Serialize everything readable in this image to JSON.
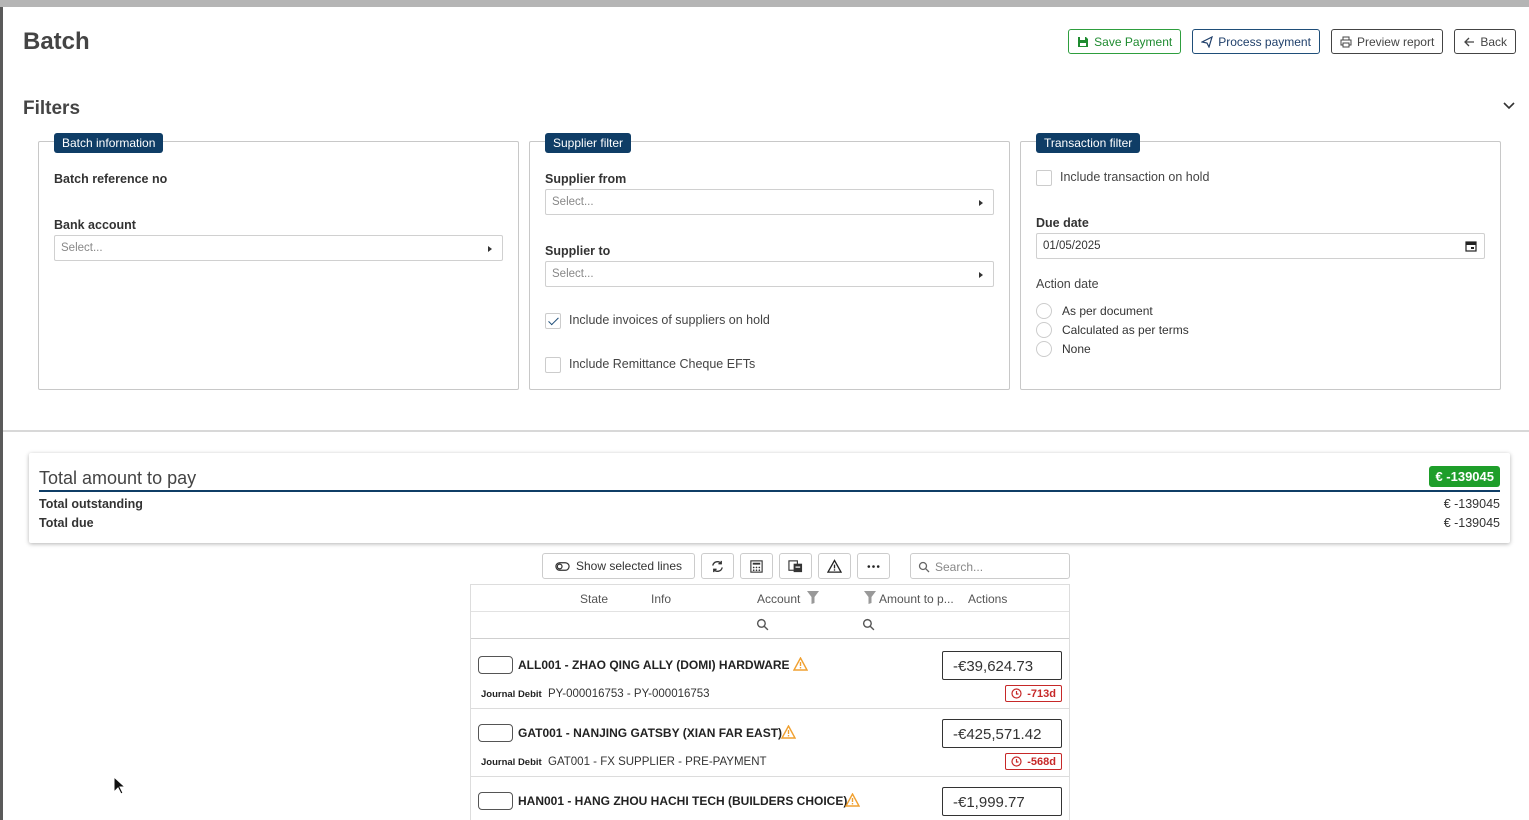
{
  "page": {
    "title": "Batch"
  },
  "actions": {
    "save": "Save Payment",
    "process": "Process payment",
    "preview": "Preview report",
    "back": "Back"
  },
  "filters": {
    "title": "Filters",
    "batch_info": {
      "tag": "Batch information",
      "ref_label": "Batch reference no",
      "bank_label": "Bank account",
      "bank_placeholder": "Select..."
    },
    "supplier": {
      "tag": "Supplier filter",
      "from_label": "Supplier from",
      "from_placeholder": "Select...",
      "to_label": "Supplier to",
      "to_placeholder": "Select...",
      "include_on_hold": "Include invoices of suppliers on hold",
      "include_on_hold_checked": true,
      "include_remittance": "Include Remittance Cheque EFTs",
      "include_remittance_checked": false
    },
    "transaction": {
      "tag": "Transaction filter",
      "include_hold": "Include transaction on hold",
      "include_hold_checked": false,
      "due_label": "Due date",
      "due_value": "01/05/2025",
      "action_label": "Action date",
      "options": [
        "As per document",
        "Calculated as per terms",
        "None"
      ]
    }
  },
  "totals": {
    "title": "Total amount to pay",
    "badge": "€ -139045",
    "outstanding_label": "Total outstanding",
    "outstanding_value": "€ -139045",
    "due_label": "Total due",
    "due_value": "€ -139045"
  },
  "toolbar": {
    "show_selected": "Show selected lines",
    "search_placeholder": "Search..."
  },
  "grid": {
    "columns": {
      "state": "State",
      "info": "Info",
      "account": "Account",
      "amount": "Amount to p...",
      "actions": "Actions"
    },
    "rows": [
      {
        "name": "ALL001 - ZHAO QING ALLY (DOMI) HARDWARE",
        "type": "Journal Debit",
        "desc": "PY-000016753 - PY-000016753",
        "amount": "-€39,624.73",
        "days": "-713d"
      },
      {
        "name": "GAT001 - NANJING GATSBY (XIAN FAR EAST)",
        "type": "Journal Debit",
        "desc": "GAT001 - FX SUPPLIER - PRE-PAYMENT",
        "amount": "-€425,571.42",
        "days": "-568d"
      },
      {
        "name": "HAN001 - HANG ZHOU HACHI TECH (BUILDERS CHOICE)",
        "type": "",
        "desc": "",
        "amount": "-€1,999.77",
        "days": ""
      }
    ]
  },
  "colors": {
    "brand": "#0f3d66",
    "success": "#1e9e2a",
    "danger": "#c62828",
    "warning": "#f0a030"
  }
}
